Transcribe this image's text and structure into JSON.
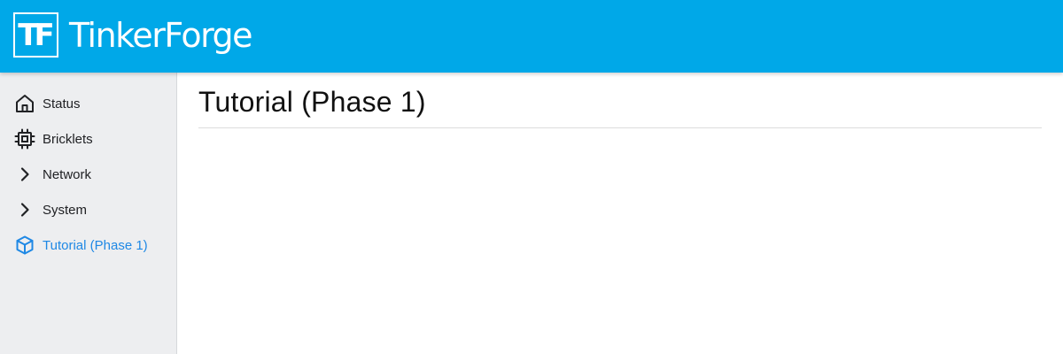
{
  "app": {
    "logo_mark": "TF",
    "logo_text": "TinkerForge",
    "brand_color": "#00a8e8",
    "accent_color": "#1e88e5"
  },
  "sidebar": {
    "items": [
      {
        "label": "Status",
        "icon": "home-icon"
      },
      {
        "label": "Bricklets",
        "icon": "chip-icon"
      },
      {
        "label": "Network",
        "icon": "chevron-right-icon"
      },
      {
        "label": "System",
        "icon": "chevron-right-icon"
      },
      {
        "label": "Tutorial (Phase 1)",
        "icon": "box-icon",
        "active": true
      }
    ]
  },
  "main": {
    "title": "Tutorial (Phase 1)"
  }
}
